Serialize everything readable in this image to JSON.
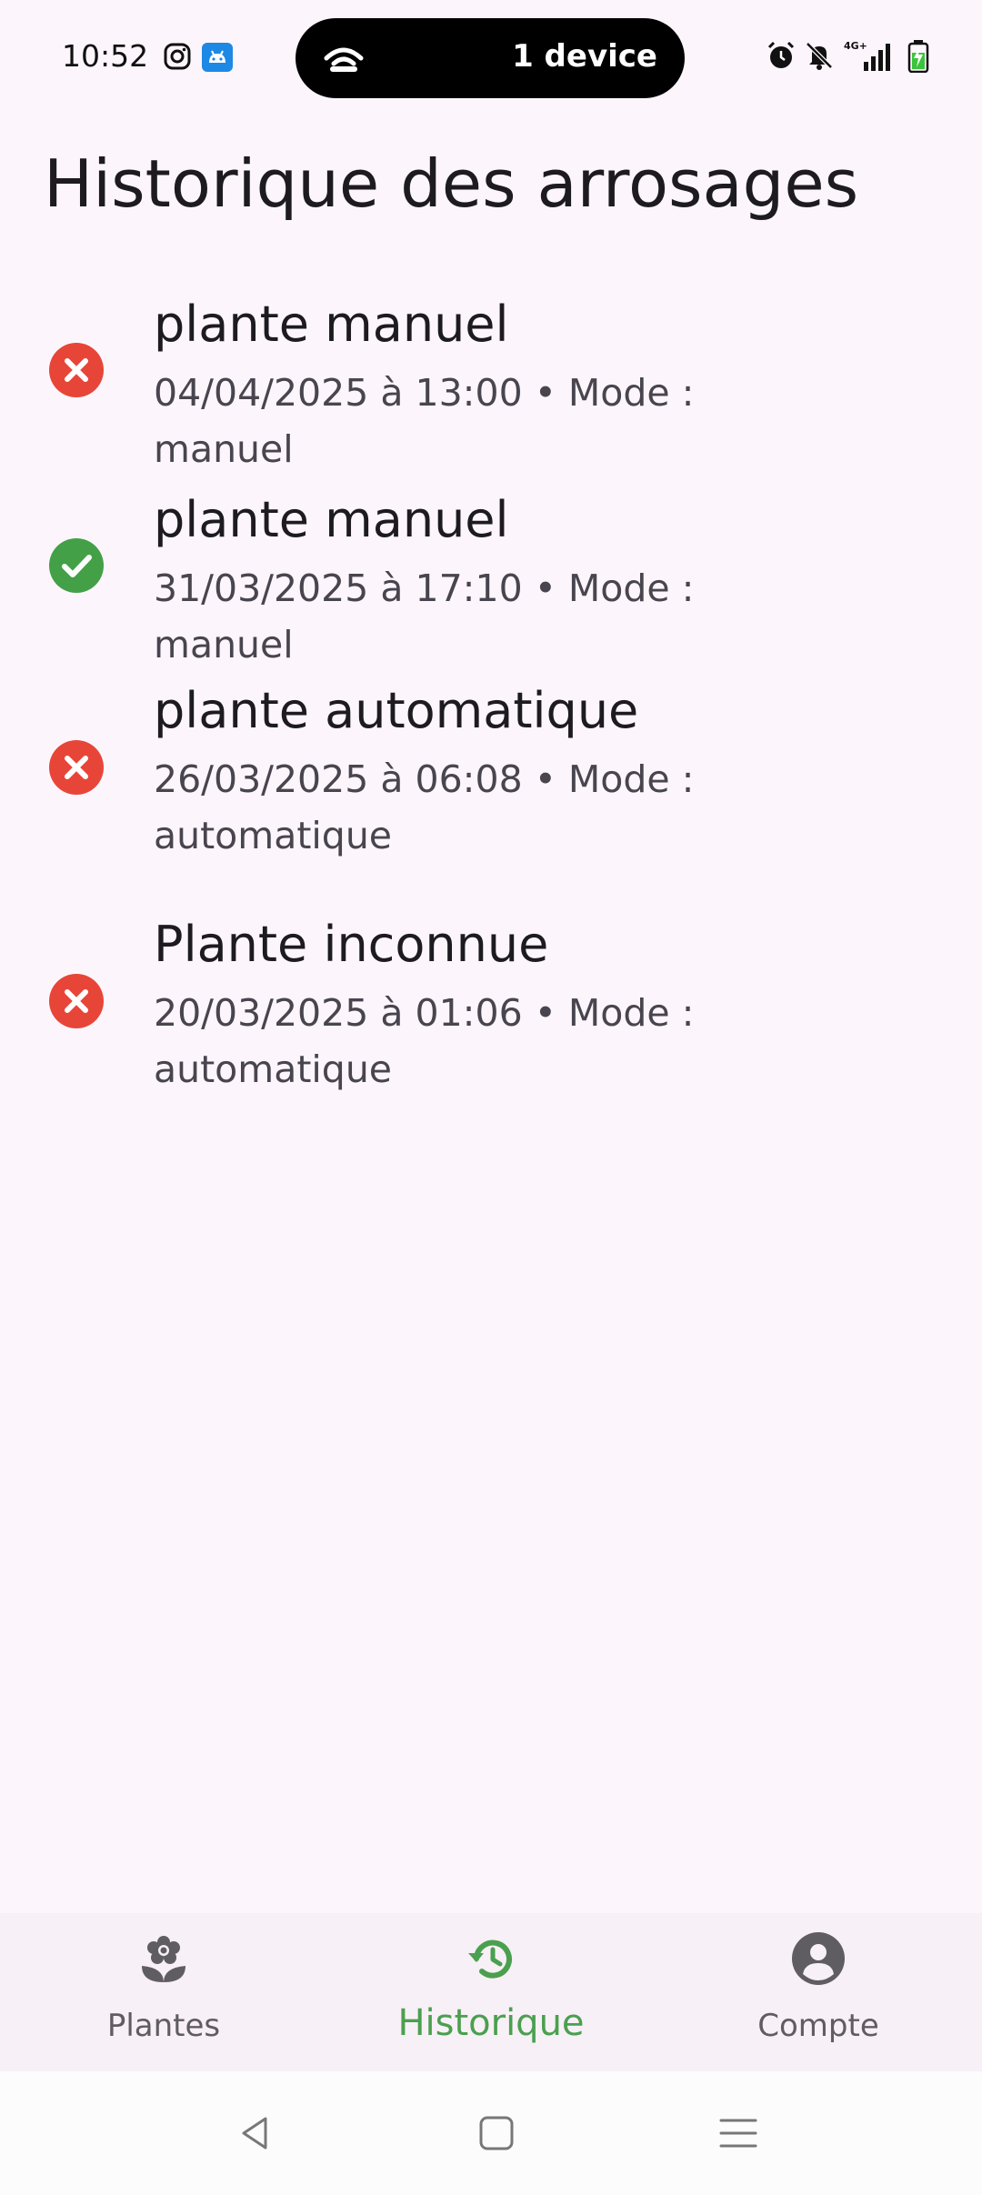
{
  "status_bar": {
    "time": "10:52",
    "island_label": "1 device",
    "network_label": "4G+",
    "icons": [
      "instagram-icon",
      "android-notification-icon",
      "wifi-icon",
      "alarm-icon",
      "bell-off-icon",
      "signal-icon",
      "battery-charging-icon"
    ]
  },
  "page": {
    "title": "Historique des arrosages"
  },
  "history": [
    {
      "title": "plante manuel",
      "meta": "04/04/2025 à 13:00 • Mode : manuel",
      "status": "error"
    },
    {
      "title": "plante manuel",
      "meta": "31/03/2025 à 17:10 • Mode : manuel",
      "status": "success"
    },
    {
      "title": "plante automatique",
      "meta": "26/03/2025 à 06:08 • Mode : automatique",
      "status": "error"
    },
    {
      "title": "Plante inconnue",
      "meta": "20/03/2025 à 01:06 • Mode : automatique",
      "status": "error"
    }
  ],
  "bottom_nav": {
    "items": [
      {
        "label": "Plantes",
        "icon": "flower-icon",
        "active": false
      },
      {
        "label": "Historique",
        "icon": "history-icon",
        "active": true
      },
      {
        "label": "Compte",
        "icon": "account-icon",
        "active": false
      }
    ]
  },
  "colors": {
    "background": "#fcf6fc",
    "error": "#e84539",
    "success": "#43a047",
    "active_nav": "#4aa04f",
    "inactive_nav": "#5f5c62"
  }
}
